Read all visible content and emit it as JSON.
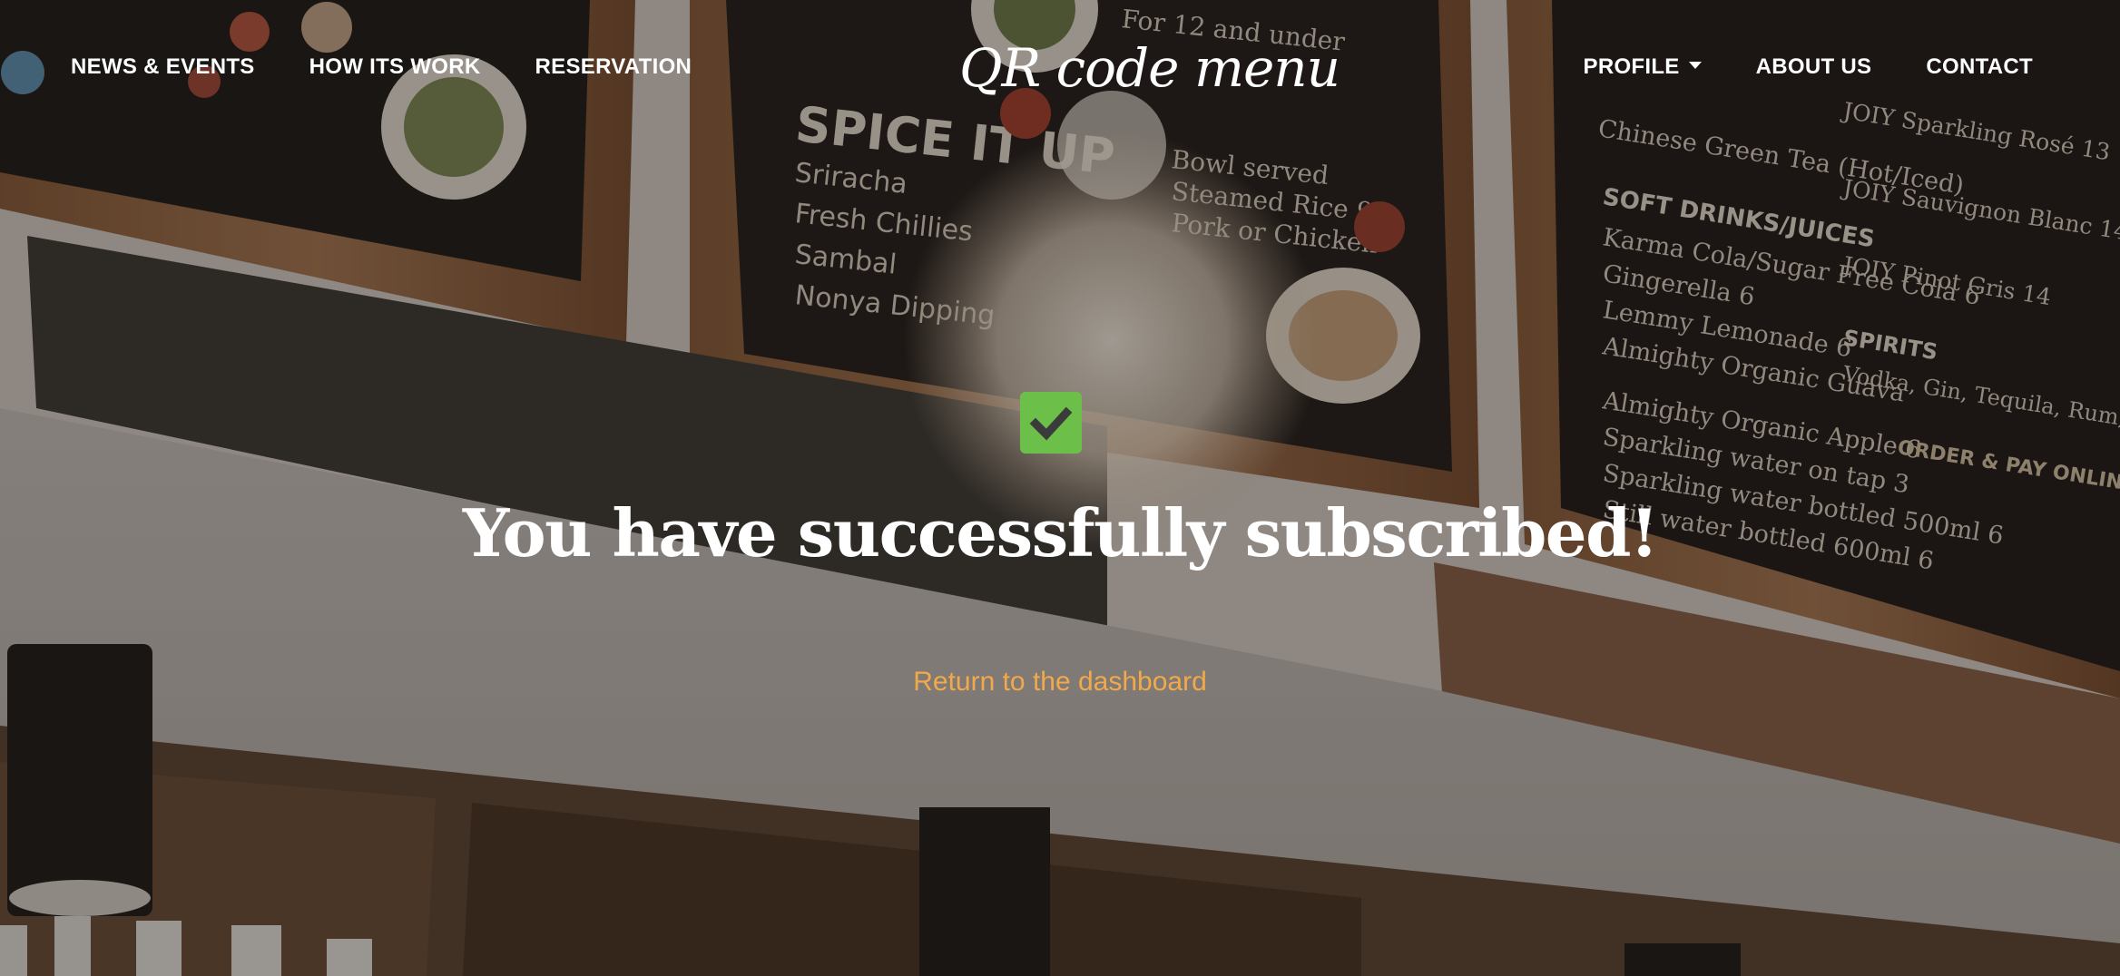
{
  "nav": {
    "left": [
      {
        "label": "NEWS & EVENTS"
      },
      {
        "label": "HOW ITS WORK"
      },
      {
        "label": "RESERVATION"
      }
    ],
    "right": [
      {
        "label": "PROFILE"
      },
      {
        "label": "ABOUT US"
      },
      {
        "label": "CONTACT"
      }
    ]
  },
  "brand": {
    "name": "QR code menu"
  },
  "main": {
    "headline": "You have successfully subscribed!",
    "return_link": "Return to the dashboard"
  },
  "colors": {
    "check_green": "#6cc04a",
    "link_orange": "#f2a94a",
    "text": "#ffffff"
  },
  "icons": {
    "success": "checkmark-icon",
    "profile_dropdown": "caret-down-icon"
  }
}
